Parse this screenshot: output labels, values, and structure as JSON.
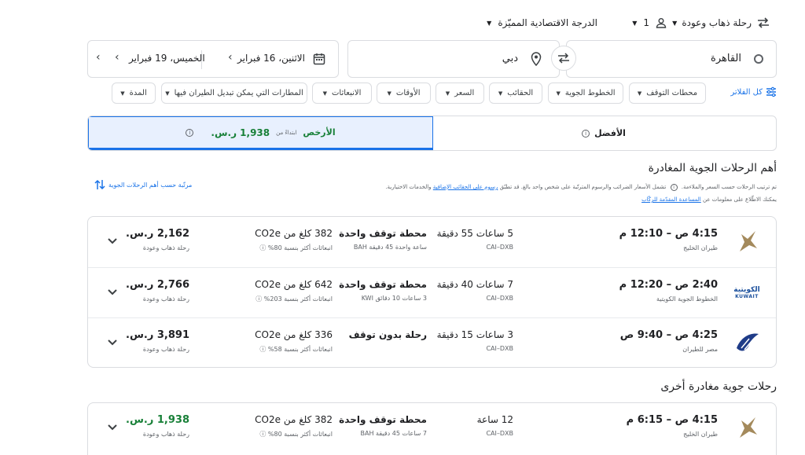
{
  "top_controls": {
    "trip_type": "رحلة ذهاب وعودة",
    "passengers": "1",
    "cabin_class": "الدرجة الاقتصادية المميّزة"
  },
  "search": {
    "origin": "القاهرة",
    "destination": "دبي",
    "depart_date": "الاثنين، 16 فبراير",
    "return_date": "الخميس، 19 فبراير"
  },
  "filters": {
    "all_filters": "كل الفلاتر",
    "items": [
      "محطات التوقف",
      "الخطوط الجوية",
      "الحقائب",
      "السعر",
      "الأوقات",
      "الانبعاثات",
      "المطارات التي يمكن تبديل الطيران فيها",
      "المدة"
    ]
  },
  "sort_tabs": {
    "best": "الأفضل",
    "cheapest": "الأرخص",
    "cheapest_from": "ابتداءً من",
    "cheapest_price": "1,938 ر.س."
  },
  "top_section": {
    "title": "أهم الرحلات الجوية المغادرة",
    "note_part1": "تم ترتيب الرحلات حسب السعر والملاءمة.",
    "note_part2": "تشمل الأسعار الضرائب والرسوم المترتّبة على شخص واحد بالغ. قد تطبّق",
    "note_link1": "رسوم على الحقائب الإضافية",
    "note_part3": "والخدمات الاختيارية.",
    "note_part4": "يمكنك الاطّلاع على معلومات عن",
    "note_link2": "المساعدة المقدّمة للركّاب",
    "sort_link": "مرتّبة حسب أهم الرحلات الجوية"
  },
  "flights": [
    {
      "times": "4:15 ص – 12:10 م",
      "airline": "طيران الخليج",
      "duration": "5 ساعات 55 دقيقة",
      "route": "CAI–DXB",
      "stops": "محطة توقف واحدة",
      "stop_detail": "ساعة واحدة 45 دقيقة BAH",
      "emissions": "382 كلغ من CO2e",
      "emissions_detail": "انبعاثات أكثر بنسبة 80%",
      "price": "2,162 ر.س.",
      "price_note": "رحلة ذهاب وعودة",
      "price_color": "#202124",
      "logo": "gulf-air-falcon"
    },
    {
      "times": "2:40 ص – 12:20 م",
      "airline": "الخطوط الجوية الكويتية",
      "duration": "7 ساعات 40 دقيقة",
      "route": "CAI–DXB",
      "stops": "محطة توقف واحدة",
      "stop_detail": "3 ساعات 10 دقائق KWI",
      "emissions": "642 كلغ من CO2e",
      "emissions_detail": "انبعاثات أكثر بنسبة 203%",
      "price": "2,766 ر.س.",
      "price_note": "رحلة ذهاب وعودة",
      "price_color": "#202124",
      "logo": "kuwait-airways",
      "logo_text": "KUWAIT"
    },
    {
      "times": "4:25 ص – 9:40 ص",
      "airline": "مصر للطيران",
      "duration": "3 ساعات 15 دقيقة",
      "route": "CAI–DXB",
      "stops": "رحلة بدون توقف",
      "stop_detail": "",
      "emissions": "336 كلغ من CO2e",
      "emissions_detail": "انبعاثات أكثر بنسبة 58%",
      "price": "3,891 ر.س.",
      "price_note": "رحلة ذهاب وعودة",
      "price_color": "#202124",
      "logo": "egyptair-horus"
    }
  ],
  "other_section": {
    "title": "رحلات جوية مغادرة أخرى"
  },
  "other_flights": [
    {
      "times": "4:15 ص – 6:15 م",
      "airline": "طيران الخليج",
      "duration": "12 ساعة",
      "route": "CAI–DXB",
      "stops": "محطة توقف واحدة",
      "stop_detail": "7 ساعات 45 دقيقة BAH",
      "emissions": "382 كلغ من CO2e",
      "emissions_detail": "انبعاثات أكثر بنسبة 80%",
      "price": "1,938 ر.س.",
      "price_note": "رحلة ذهاب وعودة",
      "price_color": "#188038",
      "logo": "gulf-air-falcon"
    }
  ],
  "colors": {
    "accent": "#1a73e8",
    "selected_tab_bg": "#e8f0fe",
    "green_price": "#188038",
    "border": "#dadce0"
  }
}
